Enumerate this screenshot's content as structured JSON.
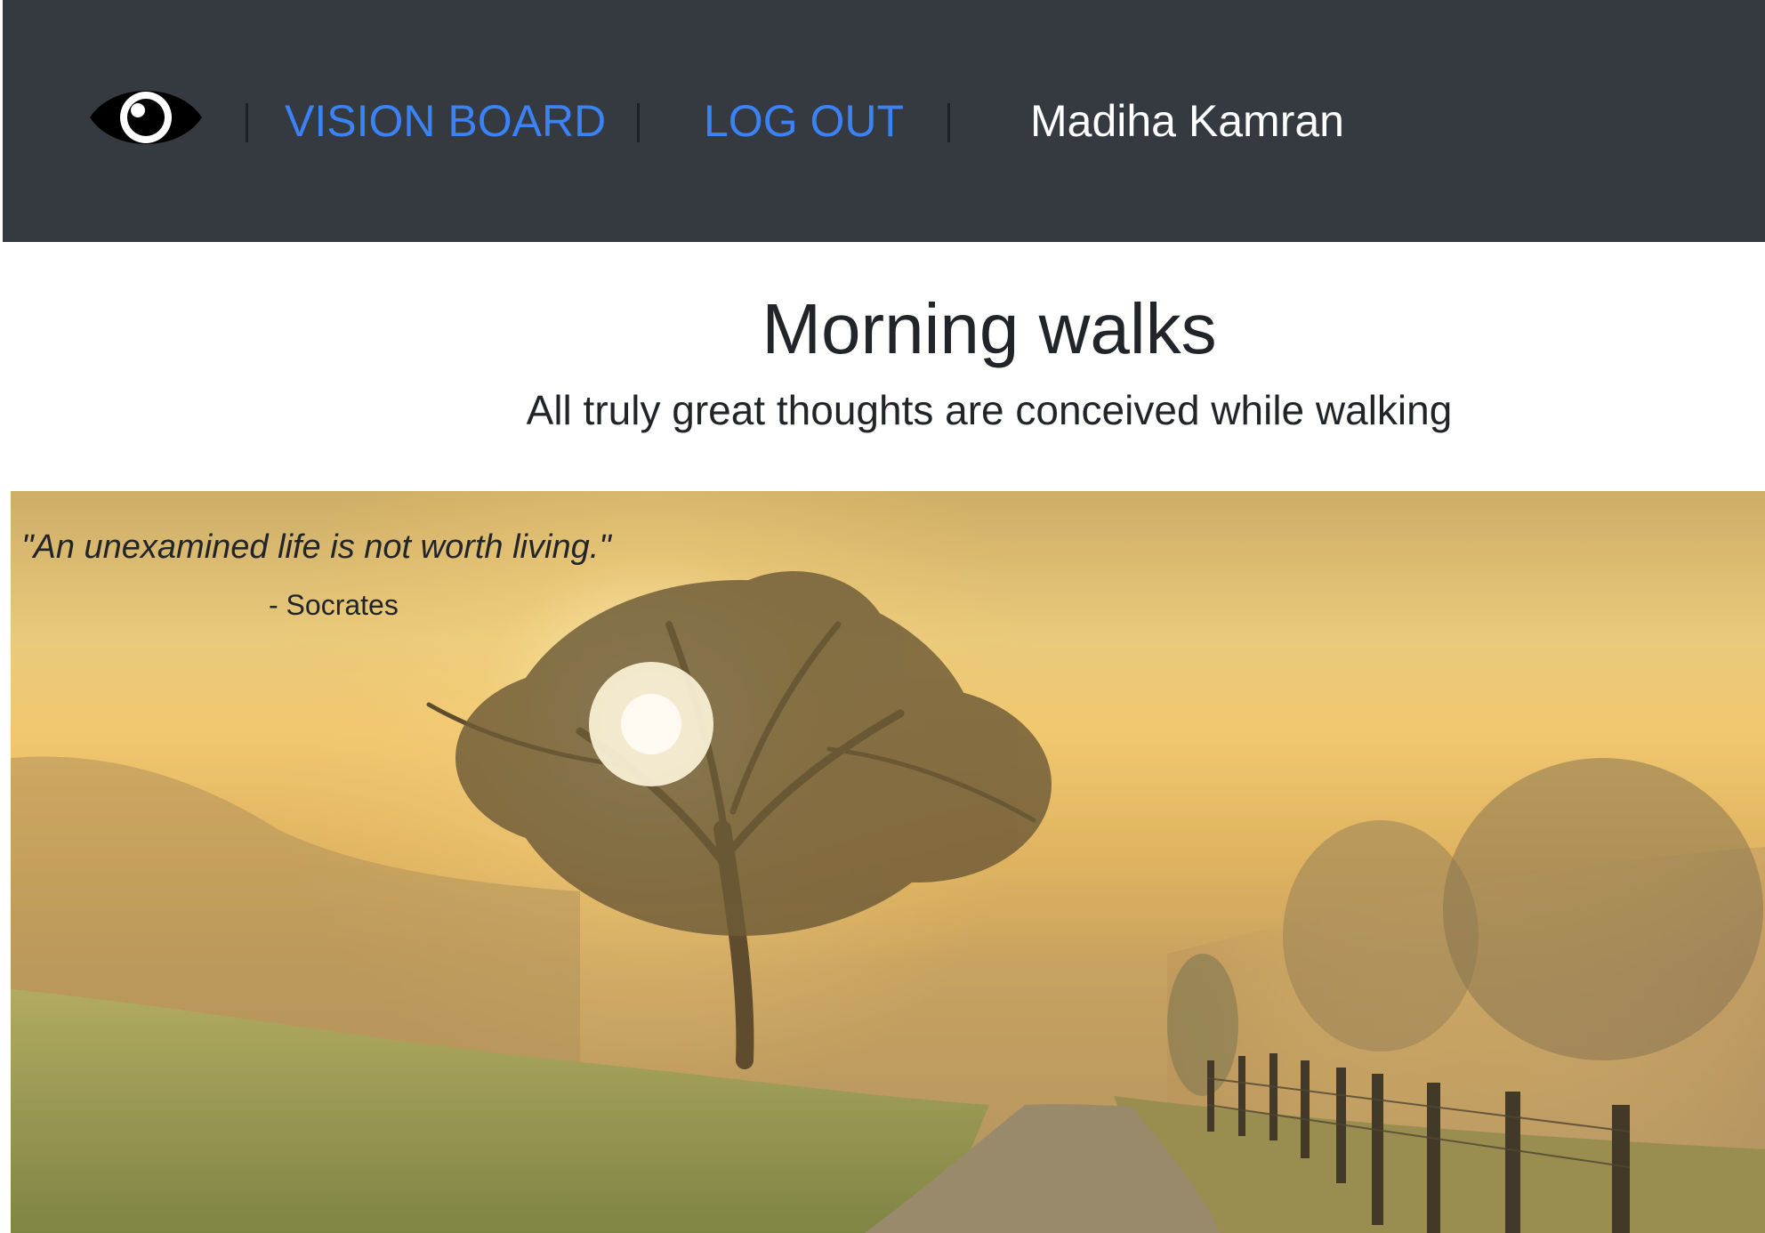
{
  "nav": {
    "logo_icon": "eye-icon",
    "vision_board_label": "VISION BOARD",
    "logout_label": "LOG OUT",
    "user_name": "Madiha Kamran",
    "link_color": "#3b82f6",
    "bar_color": "#343a40"
  },
  "page": {
    "title": "Morning walks",
    "subtitle": "All truly great thoughts are conceived while walking"
  },
  "banner": {
    "quote": "\"An unexamined life is not worth living.\"",
    "author": "- Socrates"
  }
}
